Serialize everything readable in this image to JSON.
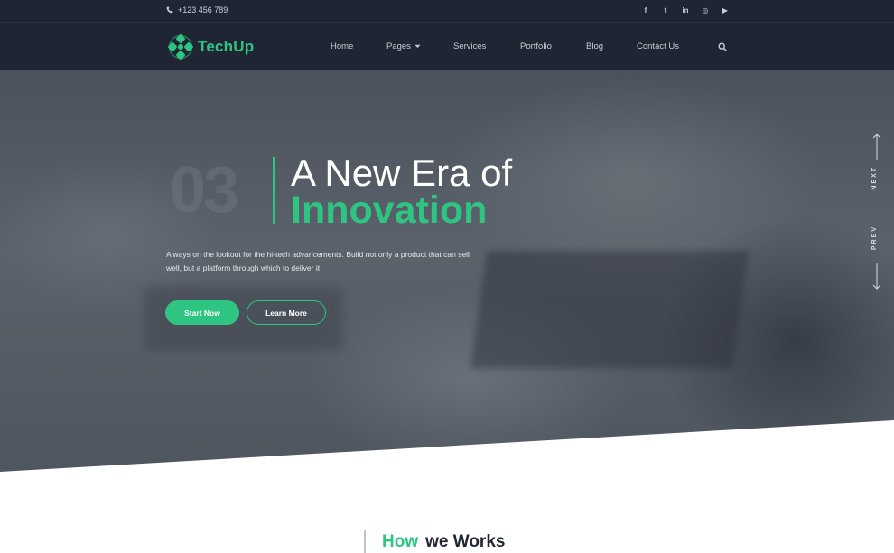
{
  "topbar": {
    "phone": "+123 456 789",
    "socials": [
      {
        "icon": "facebook-icon",
        "glyph": "f"
      },
      {
        "icon": "twitter-icon",
        "glyph": "t"
      },
      {
        "icon": "linkedin-icon",
        "glyph": "in"
      },
      {
        "icon": "instagram-icon",
        "glyph": "◎"
      },
      {
        "icon": "youtube-icon",
        "glyph": "▶"
      }
    ]
  },
  "nav": {
    "brand": "TechUp",
    "items": [
      {
        "label": "Home"
      },
      {
        "label": "Pages",
        "dropdown": true
      },
      {
        "label": "Services"
      },
      {
        "label": "Portfolio"
      },
      {
        "label": "Blog"
      },
      {
        "label": "Contact Us"
      }
    ],
    "search_icon": "search-icon"
  },
  "hero": {
    "slide_number": "03",
    "title_line1": "A New Era of",
    "title_line2": "Innovation",
    "description": "Always on the lookout for the hi-tech advancements. Build not only a product that can sell well, but a platform through which to deliver it.",
    "primary_button": "Start Now",
    "secondary_button": "Learn More",
    "next_label": "NEXT",
    "prev_label": "PREV"
  },
  "section": {
    "heading_accent": "How",
    "heading_rest": "we Works"
  },
  "colors": {
    "accent": "#2ec583",
    "dark": "#1f2532"
  }
}
